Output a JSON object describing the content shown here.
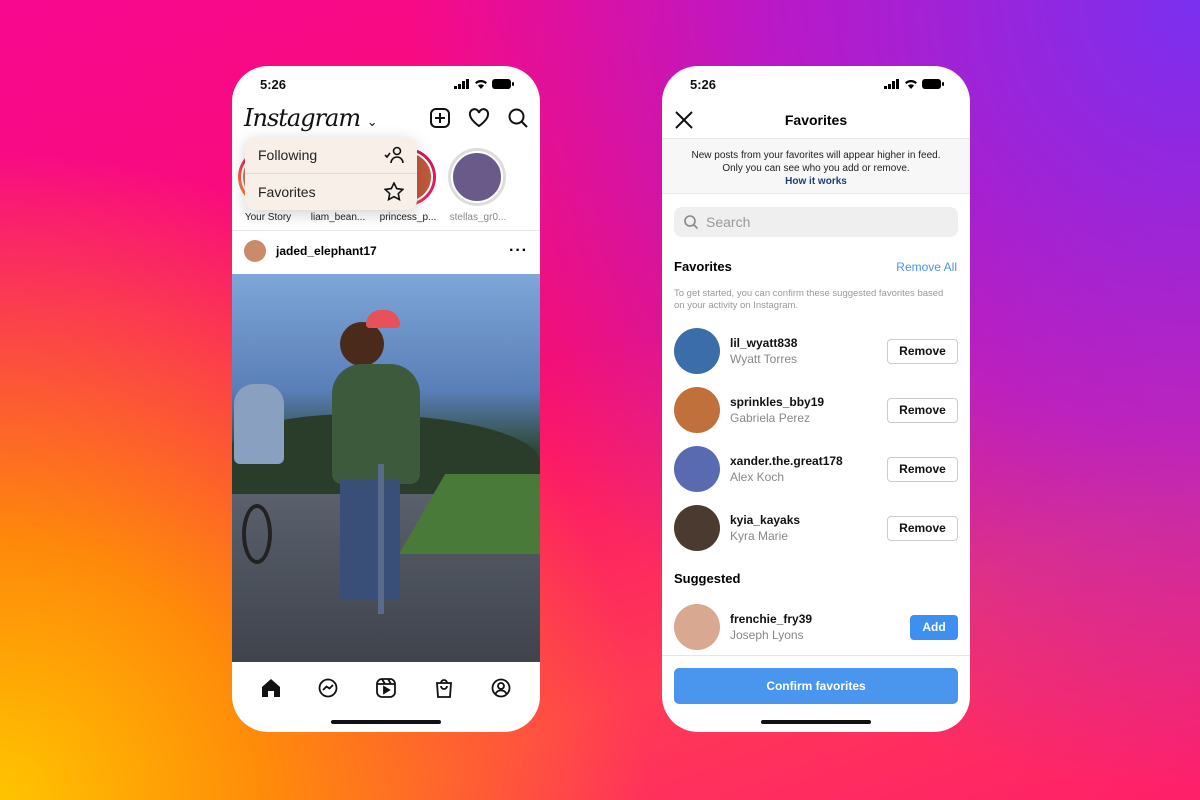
{
  "status": {
    "time": "5:26"
  },
  "feed": {
    "logo": "Instagram",
    "menu": [
      {
        "label": "Following",
        "icon": "following-icon"
      },
      {
        "label": "Favorites",
        "icon": "star-icon"
      }
    ],
    "stories": [
      {
        "label": "Your Story"
      },
      {
        "label": "liam_bean..."
      },
      {
        "label": "princess_p..."
      },
      {
        "label": "stellas_gr0..."
      }
    ],
    "post": {
      "username": "jaded_elephant17"
    },
    "nav": [
      "home-icon",
      "messenger-icon",
      "reels-icon",
      "shop-icon",
      "profile-icon"
    ]
  },
  "favorites": {
    "title": "Favorites",
    "banner_line1": "New posts from your favorites will appear higher in feed.",
    "banner_line2": "Only you can see who you add or remove.",
    "how_it_works": "How it works",
    "search_placeholder": "Search",
    "section_title": "Favorites",
    "remove_all": "Remove All",
    "description": "To get started, you can confirm these suggested favorites based on your activity on Instagram.",
    "list": [
      {
        "username": "lil_wyatt838",
        "name": "Wyatt Torres",
        "action": "Remove"
      },
      {
        "username": "sprinkles_bby19",
        "name": "Gabriela Perez",
        "action": "Remove"
      },
      {
        "username": "xander.the.great178",
        "name": "Alex Koch",
        "action": "Remove"
      },
      {
        "username": "kyia_kayaks",
        "name": "Kyra Marie",
        "action": "Remove"
      }
    ],
    "suggested_title": "Suggested",
    "suggested": [
      {
        "username": "frenchie_fry39",
        "name": "Joseph Lyons",
        "action": "Add"
      }
    ],
    "confirm": "Confirm favorites"
  },
  "colors": {
    "accent": "#3d8ff0",
    "link": "#1c3d6e"
  }
}
